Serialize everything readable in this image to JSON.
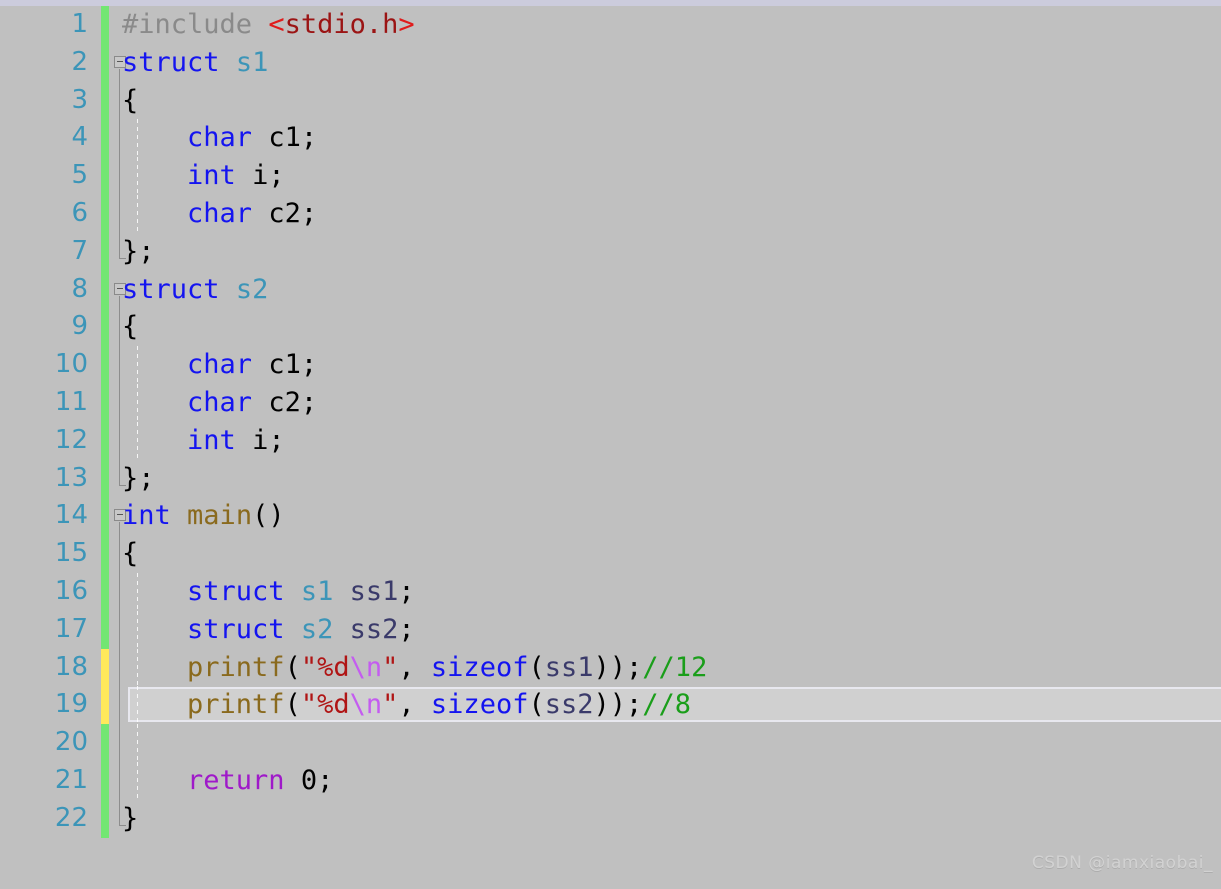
{
  "editor": {
    "language": "C",
    "background_color": "#c0c0c0",
    "current_line": 19,
    "total_lines": 22,
    "gutter": {
      "vcs_modified_color": "#ffe95c",
      "vcs_unchanged_color": "#73e673",
      "line_number_color": "#3c95b8"
    },
    "colors": {
      "keyword": "#1414f0",
      "type": "#3c95b8",
      "function": "#8a6a1e",
      "variable": "#3a3a6a",
      "string": "#b01515",
      "escape": "#c45cf0",
      "comment": "#1a9e1a",
      "preprocessor": "#8a8a8a",
      "header": "#9b1414",
      "return_keyword": "#9f19c9"
    }
  },
  "lines": [
    {
      "number": "1",
      "vcs": "green",
      "fold": "none",
      "indent_guides": 0,
      "text": "#include <stdio.h>",
      "tokens": [
        {
          "t": "#include",
          "c": "tk-pre"
        },
        {
          "t": " ",
          "c": "tk-punct"
        },
        {
          "t": "<",
          "c": "tk-hdr-br"
        },
        {
          "t": "stdio.h",
          "c": "tk-hdr"
        },
        {
          "t": ">",
          "c": "tk-hdr-br"
        }
      ]
    },
    {
      "number": "2",
      "vcs": "green",
      "fold": "box",
      "indent_guides": 0,
      "text": "struct s1",
      "tokens": [
        {
          "t": "struct",
          "c": "tk-kw"
        },
        {
          "t": " ",
          "c": "tk-punct"
        },
        {
          "t": "s1",
          "c": "tk-type"
        }
      ]
    },
    {
      "number": "3",
      "vcs": "green",
      "fold": "line",
      "indent_guides": 0,
      "text": "{",
      "tokens": [
        {
          "t": "{",
          "c": "tk-punct"
        }
      ]
    },
    {
      "number": "4",
      "vcs": "green",
      "fold": "line",
      "indent_guides": 1,
      "text": "    char c1;",
      "tokens": [
        {
          "t": "    ",
          "c": "tk-punct"
        },
        {
          "t": "char",
          "c": "tk-kw"
        },
        {
          "t": " ",
          "c": "tk-punct"
        },
        {
          "t": "c1",
          "c": "tk-id"
        },
        {
          "t": ";",
          "c": "tk-punct"
        }
      ]
    },
    {
      "number": "5",
      "vcs": "green",
      "fold": "line",
      "indent_guides": 1,
      "text": "    int i;",
      "tokens": [
        {
          "t": "    ",
          "c": "tk-punct"
        },
        {
          "t": "int",
          "c": "tk-kw"
        },
        {
          "t": " ",
          "c": "tk-punct"
        },
        {
          "t": "i",
          "c": "tk-id"
        },
        {
          "t": ";",
          "c": "tk-punct"
        }
      ]
    },
    {
      "number": "6",
      "vcs": "green",
      "fold": "line",
      "indent_guides": 1,
      "text": "    char c2;",
      "tokens": [
        {
          "t": "    ",
          "c": "tk-punct"
        },
        {
          "t": "char",
          "c": "tk-kw"
        },
        {
          "t": " ",
          "c": "tk-punct"
        },
        {
          "t": "c2",
          "c": "tk-id"
        },
        {
          "t": ";",
          "c": "tk-punct"
        }
      ]
    },
    {
      "number": "7",
      "vcs": "green",
      "fold": "end",
      "indent_guides": 0,
      "text": "};",
      "tokens": [
        {
          "t": "};",
          "c": "tk-punct"
        }
      ]
    },
    {
      "number": "8",
      "vcs": "green",
      "fold": "box",
      "indent_guides": 0,
      "text": "struct s2",
      "tokens": [
        {
          "t": "struct",
          "c": "tk-kw"
        },
        {
          "t": " ",
          "c": "tk-punct"
        },
        {
          "t": "s2",
          "c": "tk-type"
        }
      ]
    },
    {
      "number": "9",
      "vcs": "green",
      "fold": "line",
      "indent_guides": 0,
      "text": "{",
      "tokens": [
        {
          "t": "{",
          "c": "tk-punct"
        }
      ]
    },
    {
      "number": "10",
      "vcs": "green",
      "fold": "line",
      "indent_guides": 1,
      "text": "    char c1;",
      "tokens": [
        {
          "t": "    ",
          "c": "tk-punct"
        },
        {
          "t": "char",
          "c": "tk-kw"
        },
        {
          "t": " ",
          "c": "tk-punct"
        },
        {
          "t": "c1",
          "c": "tk-id"
        },
        {
          "t": ";",
          "c": "tk-punct"
        }
      ]
    },
    {
      "number": "11",
      "vcs": "green",
      "fold": "line",
      "indent_guides": 1,
      "text": "    char c2;",
      "tokens": [
        {
          "t": "    ",
          "c": "tk-punct"
        },
        {
          "t": "char",
          "c": "tk-kw"
        },
        {
          "t": " ",
          "c": "tk-punct"
        },
        {
          "t": "c2",
          "c": "tk-id"
        },
        {
          "t": ";",
          "c": "tk-punct"
        }
      ]
    },
    {
      "number": "12",
      "vcs": "green",
      "fold": "line",
      "indent_guides": 1,
      "text": "    int i;",
      "tokens": [
        {
          "t": "    ",
          "c": "tk-punct"
        },
        {
          "t": "int",
          "c": "tk-kw"
        },
        {
          "t": " ",
          "c": "tk-punct"
        },
        {
          "t": "i",
          "c": "tk-id"
        },
        {
          "t": ";",
          "c": "tk-punct"
        }
      ]
    },
    {
      "number": "13",
      "vcs": "green",
      "fold": "end",
      "indent_guides": 0,
      "text": "};",
      "tokens": [
        {
          "t": "};",
          "c": "tk-punct"
        }
      ]
    },
    {
      "number": "14",
      "vcs": "green",
      "fold": "box",
      "indent_guides": 0,
      "text": "int main()",
      "tokens": [
        {
          "t": "int",
          "c": "tk-kw"
        },
        {
          "t": " ",
          "c": "tk-punct"
        },
        {
          "t": "main",
          "c": "tk-fn"
        },
        {
          "t": "()",
          "c": "tk-punct"
        }
      ]
    },
    {
      "number": "15",
      "vcs": "green",
      "fold": "line",
      "indent_guides": 0,
      "text": "{",
      "tokens": [
        {
          "t": "{",
          "c": "tk-punct"
        }
      ]
    },
    {
      "number": "16",
      "vcs": "green",
      "fold": "line",
      "indent_guides": 1,
      "text": "    struct s1 ss1;",
      "tokens": [
        {
          "t": "    ",
          "c": "tk-punct"
        },
        {
          "t": "struct",
          "c": "tk-kw"
        },
        {
          "t": " ",
          "c": "tk-punct"
        },
        {
          "t": "s1",
          "c": "tk-type"
        },
        {
          "t": " ",
          "c": "tk-punct"
        },
        {
          "t": "ss1",
          "c": "tk-var"
        },
        {
          "t": ";",
          "c": "tk-punct"
        }
      ]
    },
    {
      "number": "17",
      "vcs": "green",
      "fold": "line",
      "indent_guides": 1,
      "text": "    struct s2 ss2;",
      "tokens": [
        {
          "t": "    ",
          "c": "tk-punct"
        },
        {
          "t": "struct",
          "c": "tk-kw"
        },
        {
          "t": " ",
          "c": "tk-punct"
        },
        {
          "t": "s2",
          "c": "tk-type"
        },
        {
          "t": " ",
          "c": "tk-punct"
        },
        {
          "t": "ss2",
          "c": "tk-var"
        },
        {
          "t": ";",
          "c": "tk-punct"
        }
      ]
    },
    {
      "number": "18",
      "vcs": "yellow",
      "fold": "line",
      "indent_guides": 1,
      "text": "    printf(\"%d\\n\", sizeof(ss1));//12",
      "tokens": [
        {
          "t": "    ",
          "c": "tk-punct"
        },
        {
          "t": "printf",
          "c": "tk-fn"
        },
        {
          "t": "(",
          "c": "tk-punct"
        },
        {
          "t": "\"%d",
          "c": "tk-str"
        },
        {
          "t": "\\n",
          "c": "tk-esc"
        },
        {
          "t": "\"",
          "c": "tk-str"
        },
        {
          "t": ", ",
          "c": "tk-punct"
        },
        {
          "t": "sizeof",
          "c": "tk-kw"
        },
        {
          "t": "(",
          "c": "tk-punct"
        },
        {
          "t": "ss1",
          "c": "tk-var"
        },
        {
          "t": "));",
          "c": "tk-punct"
        },
        {
          "t": "//12",
          "c": "tk-cmt"
        }
      ]
    },
    {
      "number": "19",
      "vcs": "yellow",
      "fold": "line",
      "indent_guides": 1,
      "current": true,
      "text": "    printf(\"%d\\n\", sizeof(ss2));//8",
      "tokens": [
        {
          "t": "    ",
          "c": "tk-punct"
        },
        {
          "t": "printf",
          "c": "tk-fn"
        },
        {
          "t": "(",
          "c": "tk-punct"
        },
        {
          "t": "\"%d",
          "c": "tk-str"
        },
        {
          "t": "\\n",
          "c": "tk-esc"
        },
        {
          "t": "\"",
          "c": "tk-str"
        },
        {
          "t": ", ",
          "c": "tk-punct"
        },
        {
          "t": "sizeof",
          "c": "tk-kw"
        },
        {
          "t": "(",
          "c": "tk-punct"
        },
        {
          "t": "ss2",
          "c": "tk-var"
        },
        {
          "t": "));",
          "c": "tk-punct"
        },
        {
          "t": "//8",
          "c": "tk-cmt"
        }
      ]
    },
    {
      "number": "20",
      "vcs": "green",
      "fold": "line",
      "indent_guides": 1,
      "text": "",
      "tokens": []
    },
    {
      "number": "21",
      "vcs": "green",
      "fold": "line",
      "indent_guides": 1,
      "text": "    return 0;",
      "tokens": [
        {
          "t": "    ",
          "c": "tk-punct"
        },
        {
          "t": "return",
          "c": "tk-ret"
        },
        {
          "t": " ",
          "c": "tk-punct"
        },
        {
          "t": "0",
          "c": "tk-id"
        },
        {
          "t": ";",
          "c": "tk-punct"
        }
      ]
    },
    {
      "number": "22",
      "vcs": "green",
      "fold": "end",
      "indent_guides": 0,
      "text": "}",
      "tokens": [
        {
          "t": "}",
          "c": "tk-punct"
        }
      ]
    }
  ],
  "watermark": {
    "text": "CSDN @iamxiaobai_"
  }
}
